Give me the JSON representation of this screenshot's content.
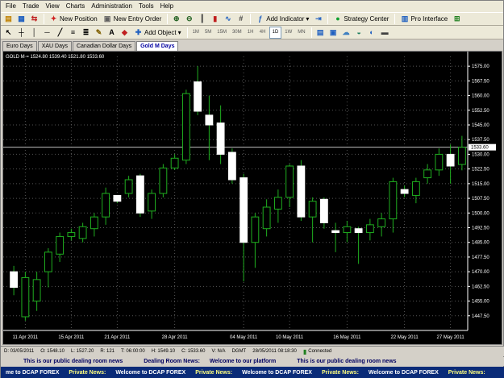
{
  "menu": {
    "file": "File",
    "trade": "Trade",
    "view": "View",
    "charts": "Charts",
    "administration": "Administration",
    "tools": "Tools",
    "help": "Help"
  },
  "toolbar1": {
    "new_position": "New Position",
    "new_entry_order": "New Entry Order",
    "add_indicator": "Add Indicator",
    "strategy_center": "Strategy Center",
    "pro_interface": "Pro Interface"
  },
  "toolbar2": {
    "add_object": "Add Object",
    "timeframes": [
      "1M",
      "5M",
      "15M",
      "30M",
      "1H",
      "4H",
      "1D",
      "1W",
      "MN"
    ],
    "active_timeframe": "1D"
  },
  "tabs": [
    {
      "label": "Euro Days",
      "active": false
    },
    {
      "label": "XAU Days",
      "active": false
    },
    {
      "label": "Canadian Dollar Days",
      "active": false
    },
    {
      "label": "Gold M Days",
      "active": true
    }
  ],
  "chart": {
    "header": "GOLD M = 1524.80 1539.40 1521.80 1533.60",
    "current_price_label": "1533.60",
    "current_price": 1533.6
  },
  "chart_data": {
    "type": "candlestick",
    "title": "GOLD M",
    "ylim": [
      1440,
      1580
    ],
    "y_ticks": [
      1447.5,
      1455.0,
      1462.5,
      1470.0,
      1477.5,
      1485.0,
      1492.5,
      1500.0,
      1507.5,
      1515.0,
      1522.5,
      1530.0,
      1537.5,
      1545.0,
      1552.5,
      1560.0,
      1567.5,
      1575.0
    ],
    "x_labels": [
      "11 Apr 2011",
      "15 Apr 2011",
      "21 Apr 2011",
      "28 Apr 2011",
      "04 May 2011",
      "10 May 2011",
      "16 May 2011",
      "22 May 2011",
      "27 May 2011"
    ],
    "x_label_index": [
      1,
      5,
      9,
      14,
      20,
      24,
      29,
      34,
      38
    ],
    "colors": {
      "up": "#000000",
      "down": "#ffffff",
      "wick": "#1fae1f",
      "grid": "#555555",
      "axis_text": "#ffffff"
    },
    "candles": [
      {
        "o": 1470,
        "h": 1473,
        "l": 1458,
        "c": 1462
      },
      {
        "o": 1447,
        "h": 1470,
        "l": 1445,
        "c": 1467
      },
      {
        "o": 1455,
        "h": 1470,
        "l": 1450,
        "c": 1466
      },
      {
        "o": 1470,
        "h": 1482,
        "l": 1462,
        "c": 1480
      },
      {
        "o": 1479,
        "h": 1490,
        "l": 1475,
        "c": 1488
      },
      {
        "o": 1488,
        "h": 1492,
        "l": 1486,
        "c": 1490
      },
      {
        "o": 1487,
        "h": 1495,
        "l": 1485,
        "c": 1493
      },
      {
        "o": 1492,
        "h": 1500,
        "l": 1488,
        "c": 1498
      },
      {
        "o": 1498,
        "h": 1513,
        "l": 1494,
        "c": 1510
      },
      {
        "o": 1509,
        "h": 1507,
        "l": 1505,
        "c": 1506
      },
      {
        "o": 1510,
        "h": 1519,
        "l": 1508,
        "c": 1517
      },
      {
        "o": 1519,
        "h": 1520,
        "l": 1498,
        "c": 1500
      },
      {
        "o": 1501,
        "h": 1512,
        "l": 1497,
        "c": 1510
      },
      {
        "o": 1510,
        "h": 1525,
        "l": 1508,
        "c": 1523
      },
      {
        "o": 1523,
        "h": 1530,
        "l": 1522,
        "c": 1528
      },
      {
        "o": 1527,
        "h": 1563,
        "l": 1525,
        "c": 1561
      },
      {
        "o": 1567,
        "h": 1575,
        "l": 1550,
        "c": 1552
      },
      {
        "o": 1550,
        "h": 1560,
        "l": 1527,
        "c": 1545
      },
      {
        "o": 1546,
        "h": 1555,
        "l": 1525,
        "c": 1530
      },
      {
        "o": 1531,
        "h": 1533,
        "l": 1515,
        "c": 1517
      },
      {
        "o": 1518,
        "h": 1520,
        "l": 1465,
        "c": 1485
      },
      {
        "o": 1485,
        "h": 1500,
        "l": 1472,
        "c": 1498
      },
      {
        "o": 1492,
        "h": 1507,
        "l": 1488,
        "c": 1503
      },
      {
        "o": 1502,
        "h": 1512,
        "l": 1495,
        "c": 1508
      },
      {
        "o": 1508,
        "h": 1525,
        "l": 1503,
        "c": 1524
      },
      {
        "o": 1524,
        "h": 1527,
        "l": 1496,
        "c": 1498
      },
      {
        "o": 1498,
        "h": 1508,
        "l": 1485,
        "c": 1506
      },
      {
        "o": 1507,
        "h": 1508,
        "l": 1492,
        "c": 1495
      },
      {
        "o": 1491,
        "h": 1495,
        "l": 1480,
        "c": 1490
      },
      {
        "o": 1490,
        "h": 1496,
        "l": 1485,
        "c": 1493
      },
      {
        "o": 1492,
        "h": 1493,
        "l": 1474,
        "c": 1490
      },
      {
        "o": 1490,
        "h": 1497,
        "l": 1486,
        "c": 1494
      },
      {
        "o": 1493,
        "h": 1500,
        "l": 1488,
        "c": 1497
      },
      {
        "o": 1497,
        "h": 1518,
        "l": 1490,
        "c": 1516
      },
      {
        "o": 1512,
        "h": 1514,
        "l": 1508,
        "c": 1510
      },
      {
        "o": 1509,
        "h": 1518,
        "l": 1505,
        "c": 1516
      },
      {
        "o": 1518,
        "h": 1525,
        "l": 1515,
        "c": 1522
      },
      {
        "o": 1522,
        "h": 1533,
        "l": 1519,
        "c": 1530
      },
      {
        "o": 1530,
        "h": 1535,
        "l": 1515,
        "c": 1524
      },
      {
        "o": 1524.8,
        "h": 1539.4,
        "l": 1521.8,
        "c": 1533.6
      }
    ]
  },
  "status": {
    "d": "D: 03/05/2011",
    "o": "O: 1548.10",
    "l": "L: 1527.20",
    "r": "R: 121",
    "t": "T: 06:00:00",
    "h": "H: 1549.10",
    "c": "C: 1533.60",
    "v": "V: N/A",
    "tz": "DGMT",
    "datetime": "28/05/2011 08:18:30",
    "connection": "Connected"
  },
  "news_row1": [
    "This is our public dealing room news",
    "Dealing Room News:",
    "Welcome to our platform",
    "This is our public dealing room news"
  ],
  "news_row2": [
    "me to DCAP FOREX",
    "Private News:",
    "Welcome to DCAP FOREX",
    "Private News:",
    "Welcome to DCAP FOREX",
    "Private News:",
    "Welcome to DCAP FOREX",
    "Private News:"
  ]
}
